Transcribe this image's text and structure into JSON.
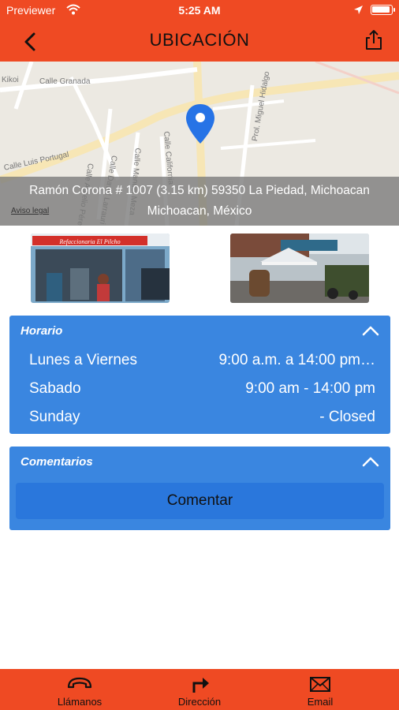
{
  "status_bar": {
    "carrier": "Previewer",
    "time": "5:25 AM"
  },
  "nav": {
    "title": "UBICACIÓN"
  },
  "map": {
    "streets": [
      "Calle Granada",
      "Calle Luis Portugal",
      "Prol. Miguel Hidalgo",
      "Calle California",
      "Calle Manuel Meza",
      "Calle Aurelio Pérez",
      "Calle David Larrauri",
      "Kikoi"
    ],
    "address_line1": "Ramón Corona # 1007 (3.15 km) 59350 La Piedad, Michoacan",
    "address_line2": "Michoacan, México",
    "legal": "Aviso legal"
  },
  "photos": {
    "sign_text": "Refaccionaria El Pilcho"
  },
  "schedule": {
    "title": "Horario",
    "rows": [
      {
        "day": "Lunes a Viernes",
        "hours": "9:00 a.m. a 14:00 pm…"
      },
      {
        "day": "Sabado",
        "hours": "9:00 am - 14:00 pm"
      },
      {
        "day": "Sunday",
        "hours": "- Closed"
      }
    ]
  },
  "comments": {
    "title": "Comentarios",
    "button": "Comentar"
  },
  "tabs": [
    {
      "label": "Llámanos",
      "icon": "phone-icon"
    },
    {
      "label": "Dirección",
      "icon": "direction-arrow-icon"
    },
    {
      "label": "Email",
      "icon": "envelope-icon"
    }
  ],
  "colors": {
    "brand_orange": "#ef4a23",
    "card_blue": "#3a86e0",
    "button_blue": "#2a77dc"
  }
}
